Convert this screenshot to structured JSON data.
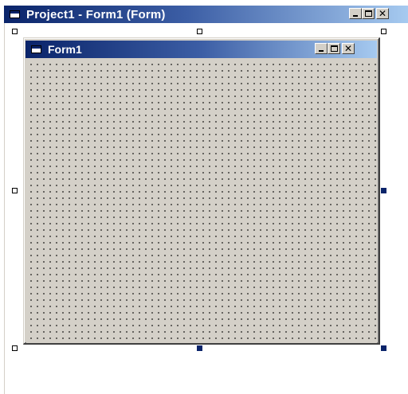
{
  "outer_window": {
    "title": "Project1 - Form1 (Form)",
    "icon": "form-designer-icon",
    "buttons": {
      "minimize": "minimize-icon",
      "maximize": "maximize-icon",
      "close": "close-icon"
    }
  },
  "form": {
    "title": "Form1",
    "icon": "form-icon",
    "buttons": {
      "minimize": "minimize-icon",
      "maximize": "maximize-icon",
      "close": "close-icon"
    },
    "background": "#d4d0c8",
    "grid": true
  },
  "colors": {
    "titlebar_start": "#0a246a",
    "titlebar_end": "#a6caf0",
    "selected_handle": "#0a246a"
  }
}
